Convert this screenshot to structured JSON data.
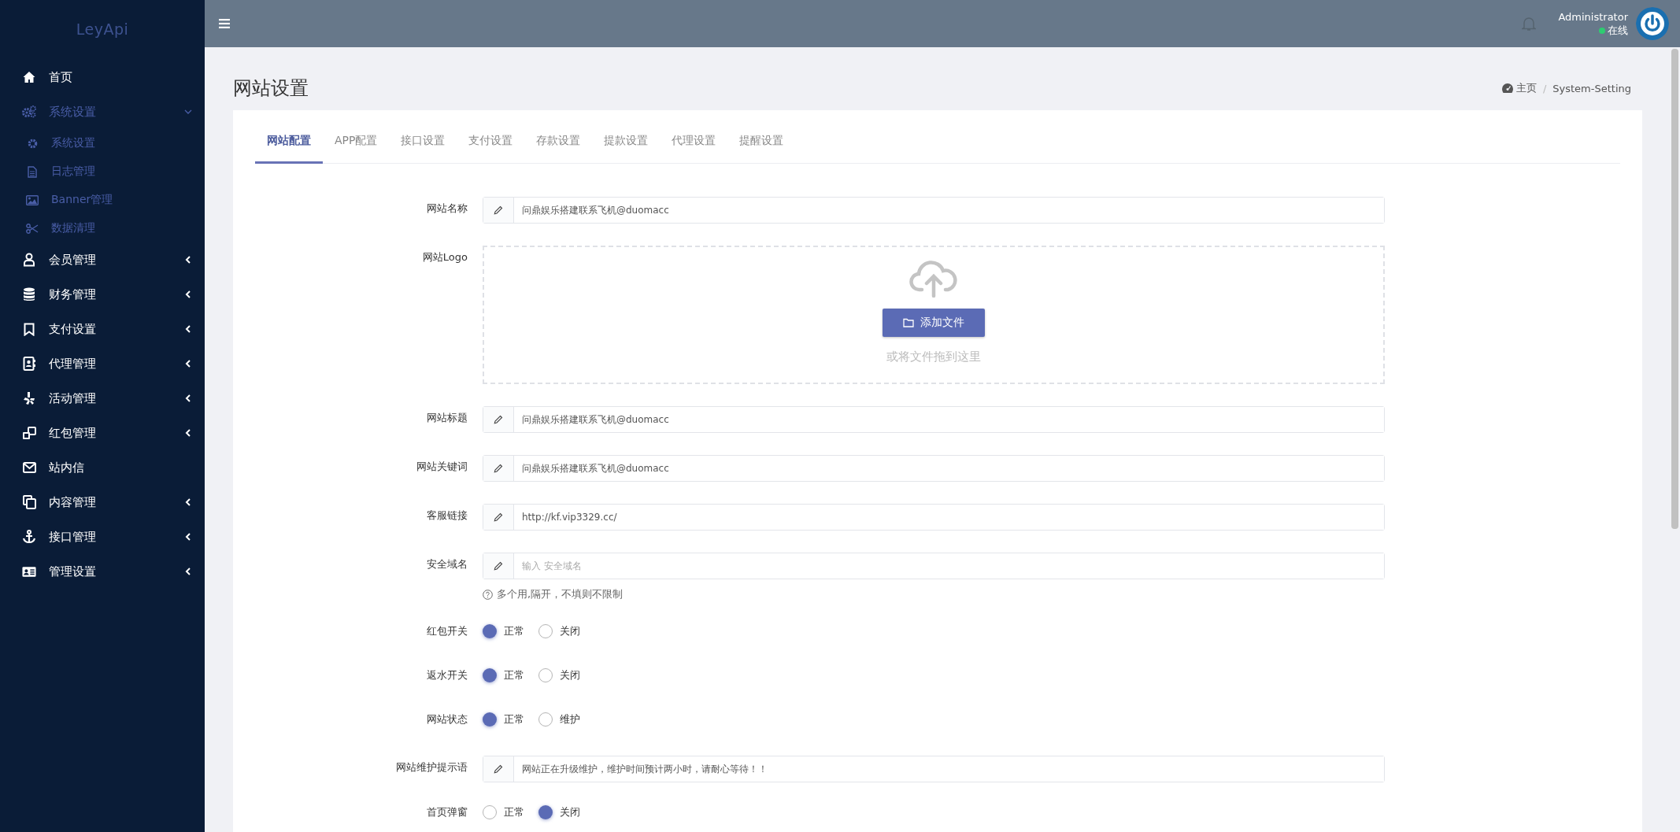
{
  "sidebar": {
    "brand": "LeyApi",
    "items": [
      {
        "label": "首页"
      },
      {
        "label": "系统设置",
        "expanded": true,
        "children": [
          {
            "label": "系统设置"
          },
          {
            "label": "日志管理"
          },
          {
            "label": "Banner管理"
          },
          {
            "label": "数据清理"
          }
        ]
      },
      {
        "label": "会员管理",
        "expanded": false
      },
      {
        "label": "财务管理",
        "expanded": false
      },
      {
        "label": "支付设置",
        "expanded": false
      },
      {
        "label": "代理管理",
        "expanded": false
      },
      {
        "label": "活动管理",
        "expanded": false
      },
      {
        "label": "红包管理",
        "expanded": false
      },
      {
        "label": "站内信"
      },
      {
        "label": "内容管理",
        "expanded": false
      },
      {
        "label": "接口管理",
        "expanded": false
      },
      {
        "label": "管理设置",
        "expanded": false
      }
    ]
  },
  "topbar": {
    "user": "Administrator",
    "status": "在线"
  },
  "page": {
    "title": "网站设置",
    "breadcrumb": [
      "主页",
      "/",
      "System-Setting"
    ]
  },
  "tabs": [
    {
      "label": "网站配置",
      "selected": true
    },
    {
      "label": "APP配置",
      "selected": false
    },
    {
      "label": "接口设置",
      "selected": false
    },
    {
      "label": "支付设置",
      "selected": false
    },
    {
      "label": "存款设置",
      "selected": false
    },
    {
      "label": "提款设置",
      "selected": false
    },
    {
      "label": "代理设置",
      "selected": false
    },
    {
      "label": "提醒设置",
      "selected": false
    }
  ],
  "form": [
    {
      "kind": "text",
      "label": "网站名称",
      "value": "问鼎娱乐搭建联系飞机@duomacc"
    },
    {
      "kind": "upload",
      "label": "网站Logo",
      "button": "添加文件",
      "hint": "或将文件拖到这里"
    },
    {
      "kind": "text",
      "label": "网站标题",
      "value": "问鼎娱乐搭建联系飞机@duomacc"
    },
    {
      "kind": "text",
      "label": "网站关键词",
      "value": "问鼎娱乐搭建联系飞机@duomacc"
    },
    {
      "kind": "text",
      "label": "客服链接",
      "value": "http://kf.vip3329.cc/"
    },
    {
      "kind": "text",
      "label": "安全域名",
      "placeholder": "输入 安全域名",
      "help": "多个用,隔开，不填则不限制"
    },
    {
      "kind": "radio",
      "label": "红包开关",
      "options": [
        {
          "label": "正常",
          "selected": true
        },
        {
          "label": "关闭",
          "selected": false
        }
      ]
    },
    {
      "kind": "radio",
      "label": "返水开关",
      "options": [
        {
          "label": "正常",
          "selected": true
        },
        {
          "label": "关闭",
          "selected": false
        }
      ]
    },
    {
      "kind": "radio",
      "label": "网站状态",
      "options": [
        {
          "label": "正常",
          "selected": true
        },
        {
          "label": "维护",
          "selected": false
        }
      ]
    },
    {
      "kind": "text",
      "label": "网站维护提示语",
      "value": "网站正在升级维护，维护时间预计两小时，请耐心等待！！"
    },
    {
      "kind": "radio",
      "label": "首页弹窗",
      "options": [
        {
          "label": "正常",
          "selected": false
        },
        {
          "label": "关闭",
          "selected": true
        }
      ]
    }
  ]
}
